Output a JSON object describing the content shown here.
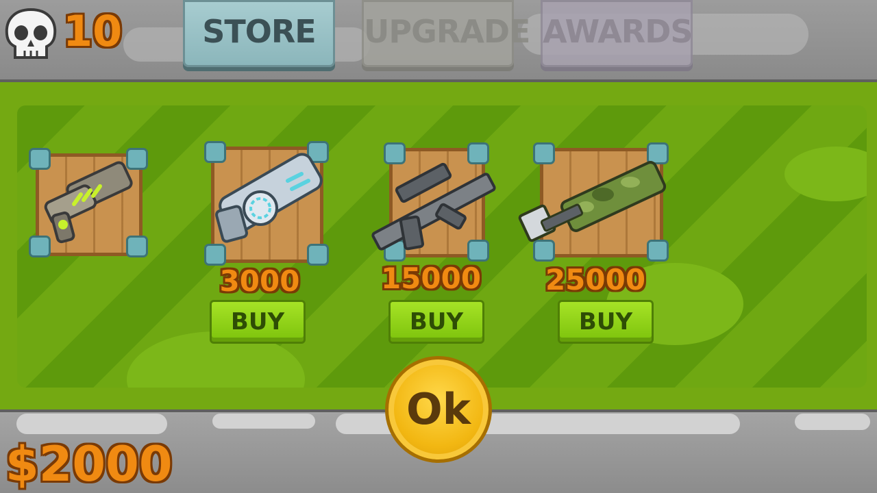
{
  "hud": {
    "kills": "10",
    "money": "$2000",
    "skull_icon": "skull-icon"
  },
  "tabs": [
    {
      "label": "STORE",
      "active": true
    },
    {
      "label": "UPGRADE",
      "active": false
    },
    {
      "label": "AWARDS",
      "active": false
    }
  ],
  "store": {
    "items": [
      {
        "weapon": "green-blaster-pistol-icon",
        "owned": true
      },
      {
        "weapon": "plasma-cannon-icon",
        "price": "3000",
        "buy_label": "BUY"
      },
      {
        "weapon": "assault-rifle-icon",
        "price": "15000",
        "buy_label": "BUY"
      },
      {
        "weapon": "camo-rocket-launcher-icon",
        "price": "25000",
        "buy_label": "BUY"
      }
    ]
  },
  "ok_label": "Ok",
  "colors": {
    "money": "#f08a12",
    "buy_button": "#8fd118",
    "ok_coin": "#f2b712",
    "active_tab": "#9cc2c6"
  }
}
